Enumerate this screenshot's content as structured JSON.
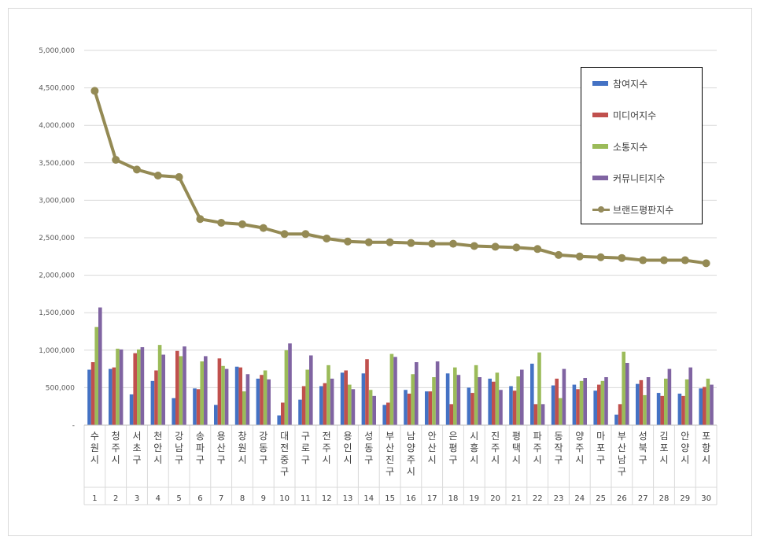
{
  "chart_data": {
    "type": "bar",
    "categories": [
      "수원시",
      "청주시",
      "서초구",
      "천안시",
      "강남구",
      "송파구",
      "용산구",
      "창원시",
      "강동구",
      "대전중구",
      "구로구",
      "전주시",
      "용인시",
      "성동구",
      "부산진구",
      "남양주시",
      "안산시",
      "은평구",
      "시흥시",
      "진주시",
      "평택시",
      "파주시",
      "동작구",
      "양주시",
      "마포구",
      "부산남구",
      "성북구",
      "김포시",
      "안양시",
      "포항시"
    ],
    "ranks": [
      "1",
      "2",
      "3",
      "4",
      "5",
      "6",
      "7",
      "8",
      "9",
      "10",
      "11",
      "12",
      "13",
      "14",
      "15",
      "16",
      "17",
      "18",
      "19",
      "20",
      "21",
      "22",
      "23",
      "24",
      "25",
      "26",
      "27",
      "28",
      "29",
      "30"
    ],
    "yticks": [
      "-",
      "500,000",
      "1,000,000",
      "1,500,000",
      "2,000,000",
      "2,500,000",
      "3,000,000",
      "3,500,000",
      "4,000,000",
      "4,500,000",
      "5,000,000"
    ],
    "ylim": [
      0,
      5000000
    ],
    "legend_position": "top-right",
    "series": [
      {
        "name": "참여지수",
        "type": "bar",
        "color": "#4472c4",
        "values": [
          740000,
          750000,
          410000,
          590000,
          360000,
          490000,
          270000,
          780000,
          620000,
          130000,
          340000,
          520000,
          700000,
          690000,
          270000,
          470000,
          450000,
          690000,
          500000,
          620000,
          520000,
          820000,
          530000,
          540000,
          460000,
          140000,
          550000,
          430000,
          420000,
          490000
        ]
      },
      {
        "name": "미디어지수",
        "type": "bar",
        "color": "#c0504d",
        "values": [
          840000,
          770000,
          960000,
          730000,
          990000,
          480000,
          890000,
          770000,
          670000,
          300000,
          520000,
          560000,
          730000,
          880000,
          300000,
          420000,
          450000,
          280000,
          430000,
          580000,
          460000,
          280000,
          620000,
          480000,
          540000,
          280000,
          600000,
          390000,
          390000,
          510000
        ]
      },
      {
        "name": "소통지수",
        "type": "bar",
        "color": "#9bbb59",
        "values": [
          1310000,
          1020000,
          1010000,
          1070000,
          920000,
          850000,
          790000,
          450000,
          730000,
          1000000,
          740000,
          800000,
          540000,
          470000,
          950000,
          680000,
          640000,
          770000,
          800000,
          700000,
          650000,
          970000,
          360000,
          590000,
          590000,
          980000,
          400000,
          620000,
          610000,
          620000
        ]
      },
      {
        "name": "커뮤니티지수",
        "type": "bar",
        "color": "#8064a2",
        "values": [
          1570000,
          1010000,
          1040000,
          940000,
          1050000,
          920000,
          750000,
          680000,
          610000,
          1090000,
          930000,
          620000,
          480000,
          390000,
          910000,
          840000,
          850000,
          670000,
          640000,
          470000,
          740000,
          280000,
          750000,
          630000,
          640000,
          830000,
          640000,
          750000,
          770000,
          540000
        ]
      },
      {
        "name": "브랜드평판지수",
        "type": "line",
        "color": "#948a54",
        "values": [
          4460000,
          3540000,
          3410000,
          3330000,
          3310000,
          2750000,
          2700000,
          2680000,
          2630000,
          2550000,
          2550000,
          2490000,
          2450000,
          2440000,
          2440000,
          2430000,
          2420000,
          2420000,
          2390000,
          2380000,
          2370000,
          2350000,
          2270000,
          2250000,
          2240000,
          2230000,
          2200000,
          2200000,
          2200000,
          2160000
        ]
      }
    ]
  }
}
